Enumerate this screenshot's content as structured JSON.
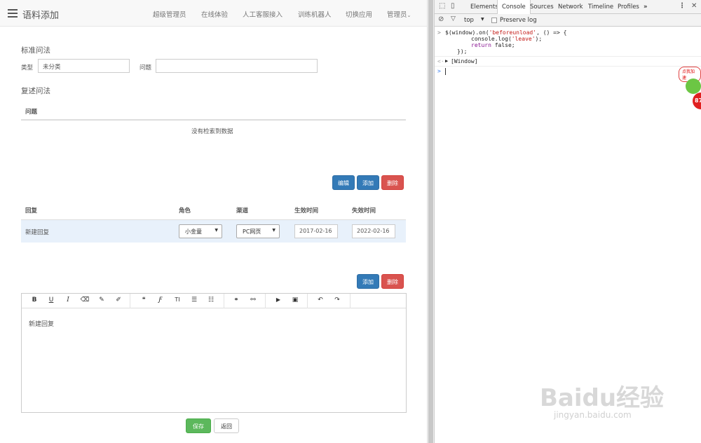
{
  "header": {
    "title": "语料添加",
    "nav": [
      "超级管理员",
      "在线体验",
      "人工客服接入",
      "训练机器人",
      "切换应用",
      "管理员"
    ]
  },
  "standard": {
    "title": "标准问法",
    "type_label": "类型",
    "type_value": "未分类",
    "question_label": "问题",
    "question_value": ""
  },
  "restate": {
    "title": "复述问法",
    "column": "问题",
    "empty": "没有检索到数据",
    "buttons": {
      "edit": "编辑",
      "add": "添加",
      "delete": "删除"
    }
  },
  "replies": {
    "columns": [
      "回复",
      "角色",
      "渠道",
      "生效时间",
      "失效时间"
    ],
    "rows": [
      {
        "reply": "新建回复",
        "role": "小金童",
        "channel": "PC网页",
        "start": "2017-02-16",
        "end": "2022-02-16"
      }
    ],
    "buttons": {
      "add": "添加",
      "delete": "删除"
    }
  },
  "editor": {
    "toolbar": [
      {
        "group": 1,
        "icons": [
          "bold-icon",
          "underline-icon",
          "italic-icon",
          "eraser-icon",
          "pencil-icon",
          "brush-icon"
        ],
        "glyphs": [
          "B",
          "U",
          "I",
          "⌫",
          "✎",
          "✐"
        ]
      },
      {
        "group": 2,
        "icons": [
          "quote-icon",
          "font-icon",
          "text-height-icon",
          "list-ul-icon",
          "list-ol-icon"
        ],
        "glyphs": [
          "❝",
          "Ƒ",
          "TI",
          "☰",
          "☷"
        ]
      },
      {
        "group": 3,
        "icons": [
          "link-icon",
          "unlink-icon"
        ],
        "glyphs": [
          "⚭",
          "⚯"
        ]
      },
      {
        "group": 4,
        "icons": [
          "video-icon",
          "image-icon"
        ],
        "glyphs": [
          "▶",
          "▣"
        ]
      },
      {
        "group": 5,
        "icons": [
          "undo-icon",
          "redo-icon"
        ],
        "glyphs": [
          "↶",
          "↷"
        ]
      }
    ],
    "content": "新建回复"
  },
  "footer": {
    "save": "保存",
    "back": "返回"
  },
  "devtools": {
    "tabs": [
      "Elements",
      "Console",
      "Sources",
      "Network",
      "Timeline",
      "Profiles"
    ],
    "more": "»",
    "context": "top",
    "preserve_log": "Preserve log",
    "code": {
      "l1a": "$(window).on(",
      "l1b": "'beforeunload'",
      "l1c": ", () => {",
      "l2a": "console.log(",
      "l2b": "'leave'",
      "l2c": ");",
      "l3a": "return",
      "l3b": " false;",
      "l4": "});"
    },
    "result": "[Window]"
  },
  "overlay": {
    "badge": "点我加速",
    "score": "87",
    "watermark": "Baidu经验",
    "watermark_url": "jingyan.baidu.com"
  },
  "colors": {
    "primary": "#337ab7",
    "danger": "#d9534f",
    "success": "#5cb85c",
    "row_highlight": "#e8f1fb"
  }
}
